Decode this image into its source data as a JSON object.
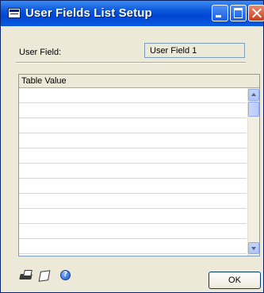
{
  "window": {
    "title": "User Fields List Setup"
  },
  "form": {
    "user_field_label": "User Field:",
    "user_field_value": "User Field 1"
  },
  "table": {
    "header": "Table Value",
    "rows": [
      "",
      "",
      "",
      "",
      "",
      "",
      "",
      "",
      "",
      "",
      ""
    ]
  },
  "footer": {
    "icons": [
      "printer-icon",
      "note-icon",
      "help-icon"
    ],
    "ok_label": "OK"
  }
}
